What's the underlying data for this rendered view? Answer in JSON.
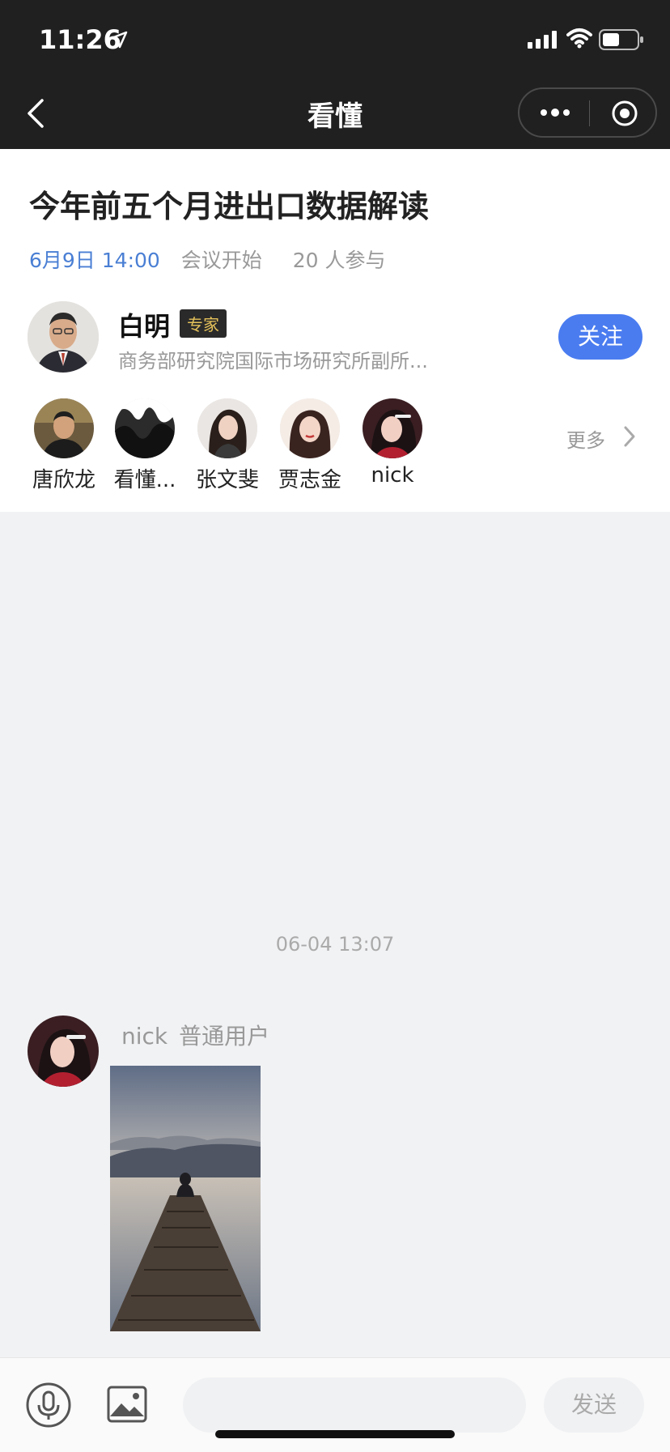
{
  "status_bar": {
    "time": "11:26"
  },
  "nav": {
    "title": "看懂"
  },
  "meeting": {
    "title": "今年前五个月进出口数据解读",
    "date": "6月9日 14:00",
    "status": "会议开始",
    "participants_text": "20 人参与"
  },
  "host": {
    "name": "白明",
    "badge": "专家",
    "title": "商务部研究院国际市场研究所副所...",
    "follow_label": "关注"
  },
  "participants": [
    {
      "name": "唐欣龙"
    },
    {
      "name": "看懂..."
    },
    {
      "name": "张文斐"
    },
    {
      "name": "贾志金"
    },
    {
      "name": "nick"
    }
  ],
  "more_label": "更多",
  "chat": {
    "timestamp": "06-04 13:07",
    "message": {
      "sender": "nick",
      "role": "普通用户"
    }
  },
  "composer": {
    "send_label": "发送",
    "placeholder": ""
  },
  "colors": {
    "accent": "#4a7cf0",
    "date_blue": "#4a7fd4",
    "badge_gold": "#e4c15a"
  }
}
